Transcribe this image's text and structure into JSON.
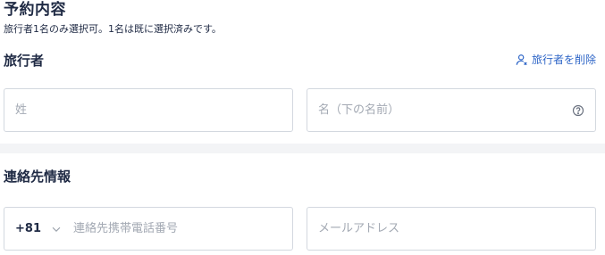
{
  "booking": {
    "title": "予約内容",
    "subtitle": "旅行者1名のみ選択可。1名は既に選択済みです。"
  },
  "traveler": {
    "heading": "旅行者",
    "remove_label": "旅行者を削除",
    "last_name_placeholder": "姓",
    "first_name_placeholder": "名（下の名前）"
  },
  "contact": {
    "heading": "連絡先情報",
    "country_code": "+81",
    "phone_placeholder": "連絡先携帯電話番号",
    "email_placeholder": "メールアドレス"
  },
  "colors": {
    "link": "#2f66c7",
    "text": "#1f2a44",
    "border": "#d3d8df",
    "placeholder": "#a3a9b3",
    "divider": "#f3f4f6"
  },
  "icons": {
    "remove_traveler": "person-remove-icon",
    "help": "help-circle-icon",
    "country_dropdown": "chevron-down-icon"
  }
}
